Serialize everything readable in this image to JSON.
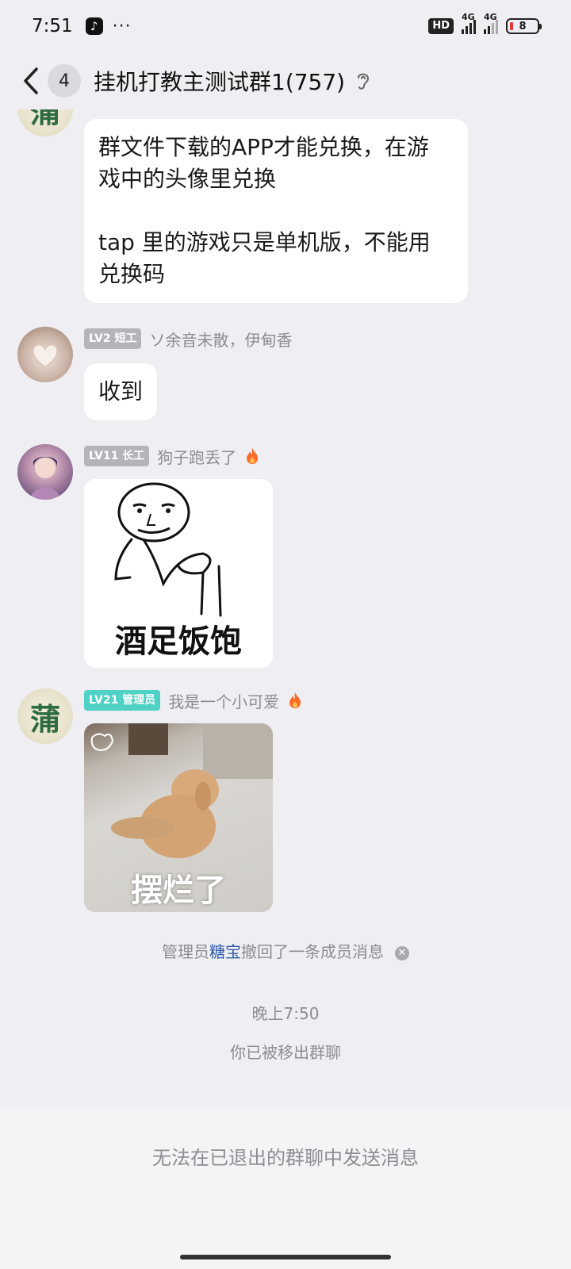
{
  "status_bar": {
    "time": "7:51",
    "more": "···",
    "hd": "HD",
    "net1": "4G",
    "net2": "4G",
    "battery": "8"
  },
  "nav": {
    "unread_count": "4",
    "title": "挂机打教主测试群1(757)"
  },
  "messages": [
    {
      "type": "text",
      "text": "群文件下载的APP才能兑换，在游\n戏中的头像里兑换\n\ntap 里的游戏只是单机版，不能用\n兑换码"
    },
    {
      "type": "text",
      "level": "LV2 短工",
      "nickname": "ソ余音未散，伊甸香",
      "text": "收到"
    },
    {
      "type": "sticker",
      "level": "LV11 长工",
      "nickname": "狗子跑丢了",
      "caption": "酒足饭饱"
    },
    {
      "type": "sticker",
      "level": "LV21 管理员",
      "nickname": "我是一个小可爱",
      "caption": "摆烂了"
    }
  ],
  "system": {
    "recall_prefix": "管理员",
    "recall_admin": "糖宝",
    "recall_suffix": "撤回了一条成员消息",
    "time": "晚上7:50",
    "removed": "你已被移出群聊"
  },
  "footer": {
    "notice": "无法在已退出的群聊中发送消息"
  },
  "colors": {
    "background": "#eeeef3",
    "admin_badge": "#4fd1c5",
    "admin_name": "#2e5aa8",
    "fire": "#ff6a2a"
  }
}
